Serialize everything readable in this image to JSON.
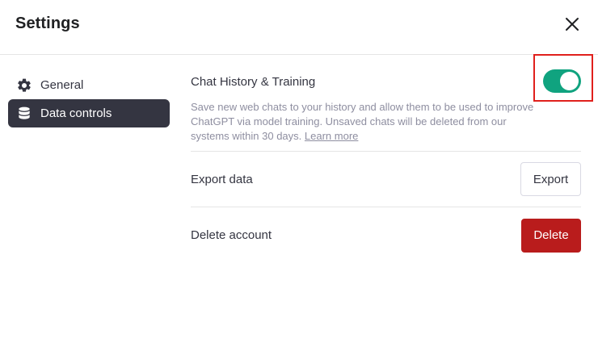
{
  "dialog": {
    "title": "Settings",
    "close_icon": "close-icon"
  },
  "sidebar": {
    "items": [
      {
        "label": "General",
        "icon": "gear-icon",
        "active": false
      },
      {
        "label": "Data controls",
        "icon": "database-icon",
        "active": true
      }
    ]
  },
  "data_controls": {
    "chat_history": {
      "label": "Chat History & Training",
      "description": "Save new web chats to your history and allow them to be used to improve ChatGPT via model training. Unsaved chats will be deleted from our systems within 30 days.",
      "learn_more": "Learn more",
      "enabled": true,
      "highlighted": true
    },
    "export": {
      "label": "Export data",
      "button_label": "Export"
    },
    "delete": {
      "label": "Delete account",
      "button_label": "Delete"
    }
  },
  "colors": {
    "toggle_on": "#10a37f",
    "danger": "#b91c1c",
    "active_nav": "#343541",
    "highlight_box": "#e0201c"
  }
}
